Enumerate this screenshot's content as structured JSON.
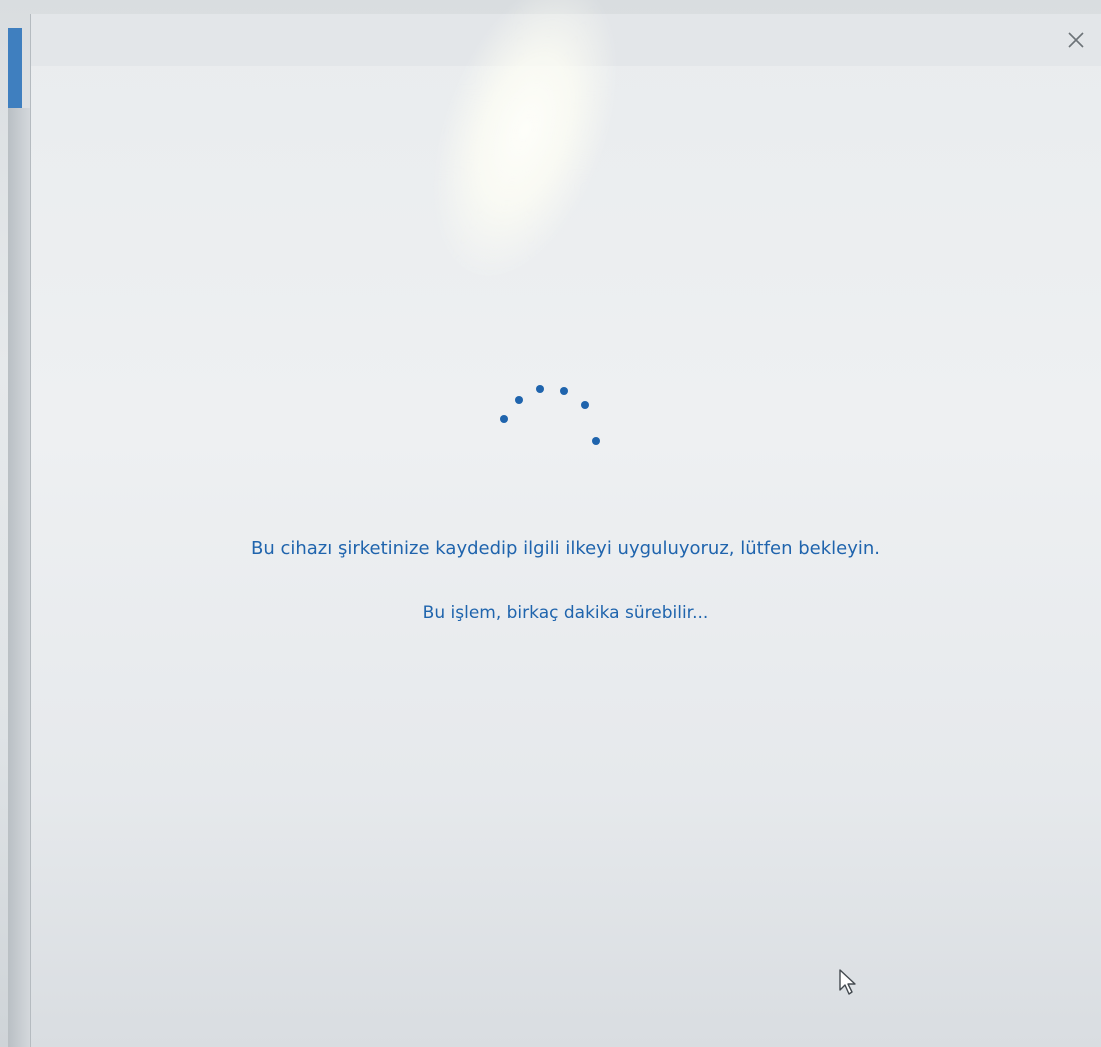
{
  "dialog": {
    "close_label": "×",
    "message": "Bu cihazı şirketinize kaydedip ilgili ilkeyi uyguluyoruz, lütfen bekleyin.",
    "submessage": "Bu işlem, birkaç dakika sürebilir..."
  },
  "icons": {
    "close": "close-icon",
    "spinner": "loading-spinner-icon",
    "cursor": "mouse-pointer-icon"
  },
  "colors": {
    "accent": "#1f64ad",
    "dialog_background": "#eceff1"
  }
}
